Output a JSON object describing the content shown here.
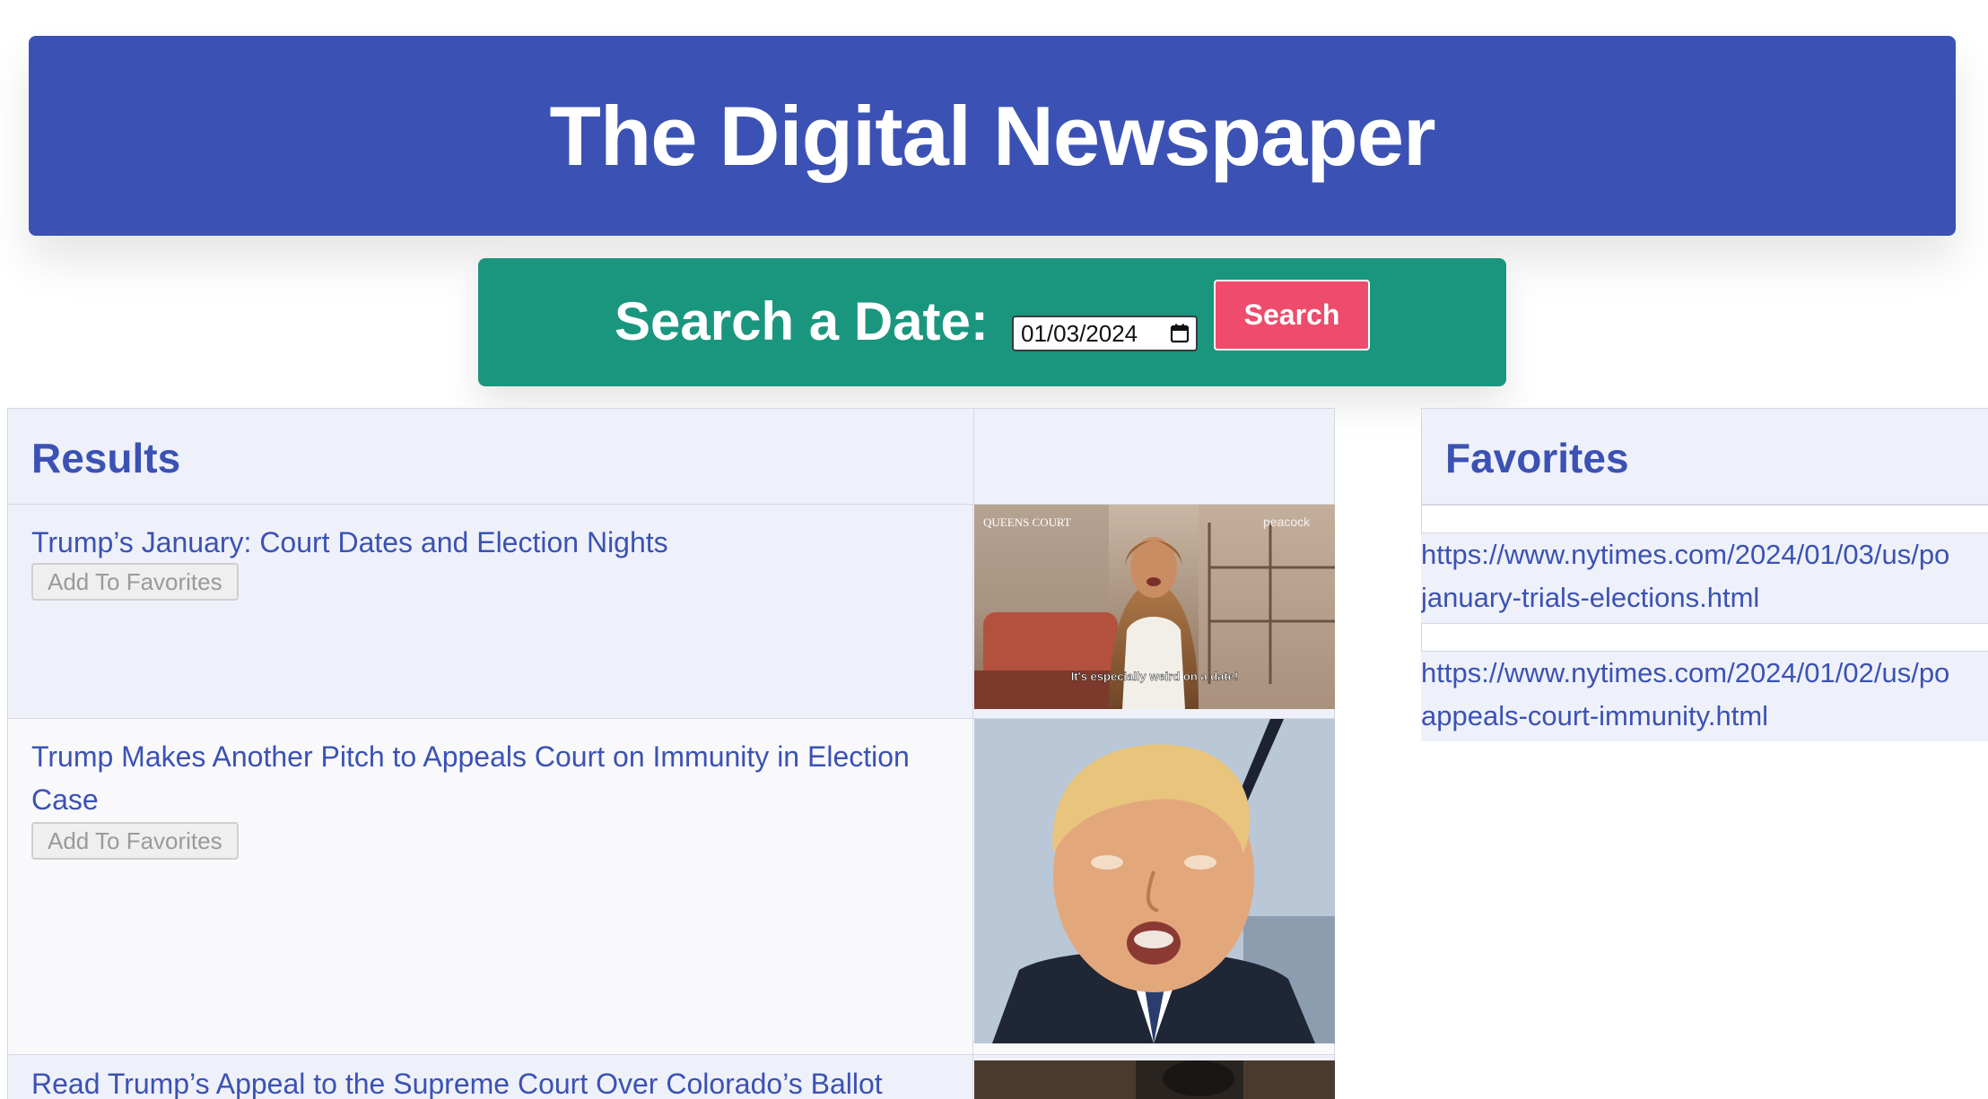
{
  "header": {
    "title": "The Digital Newspaper"
  },
  "search": {
    "label": "Search a Date:",
    "date_value": "01/03/2024",
    "button_label": "Search"
  },
  "results": {
    "title": "Results",
    "items": [
      {
        "headline": "Trump’s January: Court Dates and Election Nights",
        "favorite_label": "Add To Favorites",
        "image": {
          "overlay_top_left": "QUEENS COURT",
          "overlay_top_right": "peacock",
          "caption": "It's especially weird on a date!"
        }
      },
      {
        "headline": "Trump Makes Another Pitch to Appeals Court on Immunity in Election Case",
        "favorite_label": "Add To Favorites"
      },
      {
        "headline": "Read Trump’s Appeal to the Supreme Court Over Colorado’s Ballot"
      }
    ]
  },
  "favorites": {
    "title": "Favorites",
    "items": [
      {
        "line1": "https://www.nytimes.com/2024/01/03/us/po",
        "line2": "january-trials-elections.html"
      },
      {
        "line1": "https://www.nytimes.com/2024/01/02/us/po",
        "line2": "appeals-court-immunity.html"
      }
    ]
  },
  "colors": {
    "header_bg": "#3b52b4",
    "search_bg": "#1a967e",
    "search_button_bg": "#ef4b6c",
    "link_color": "#3b52b4",
    "panel_bg": "#eff1fa"
  }
}
